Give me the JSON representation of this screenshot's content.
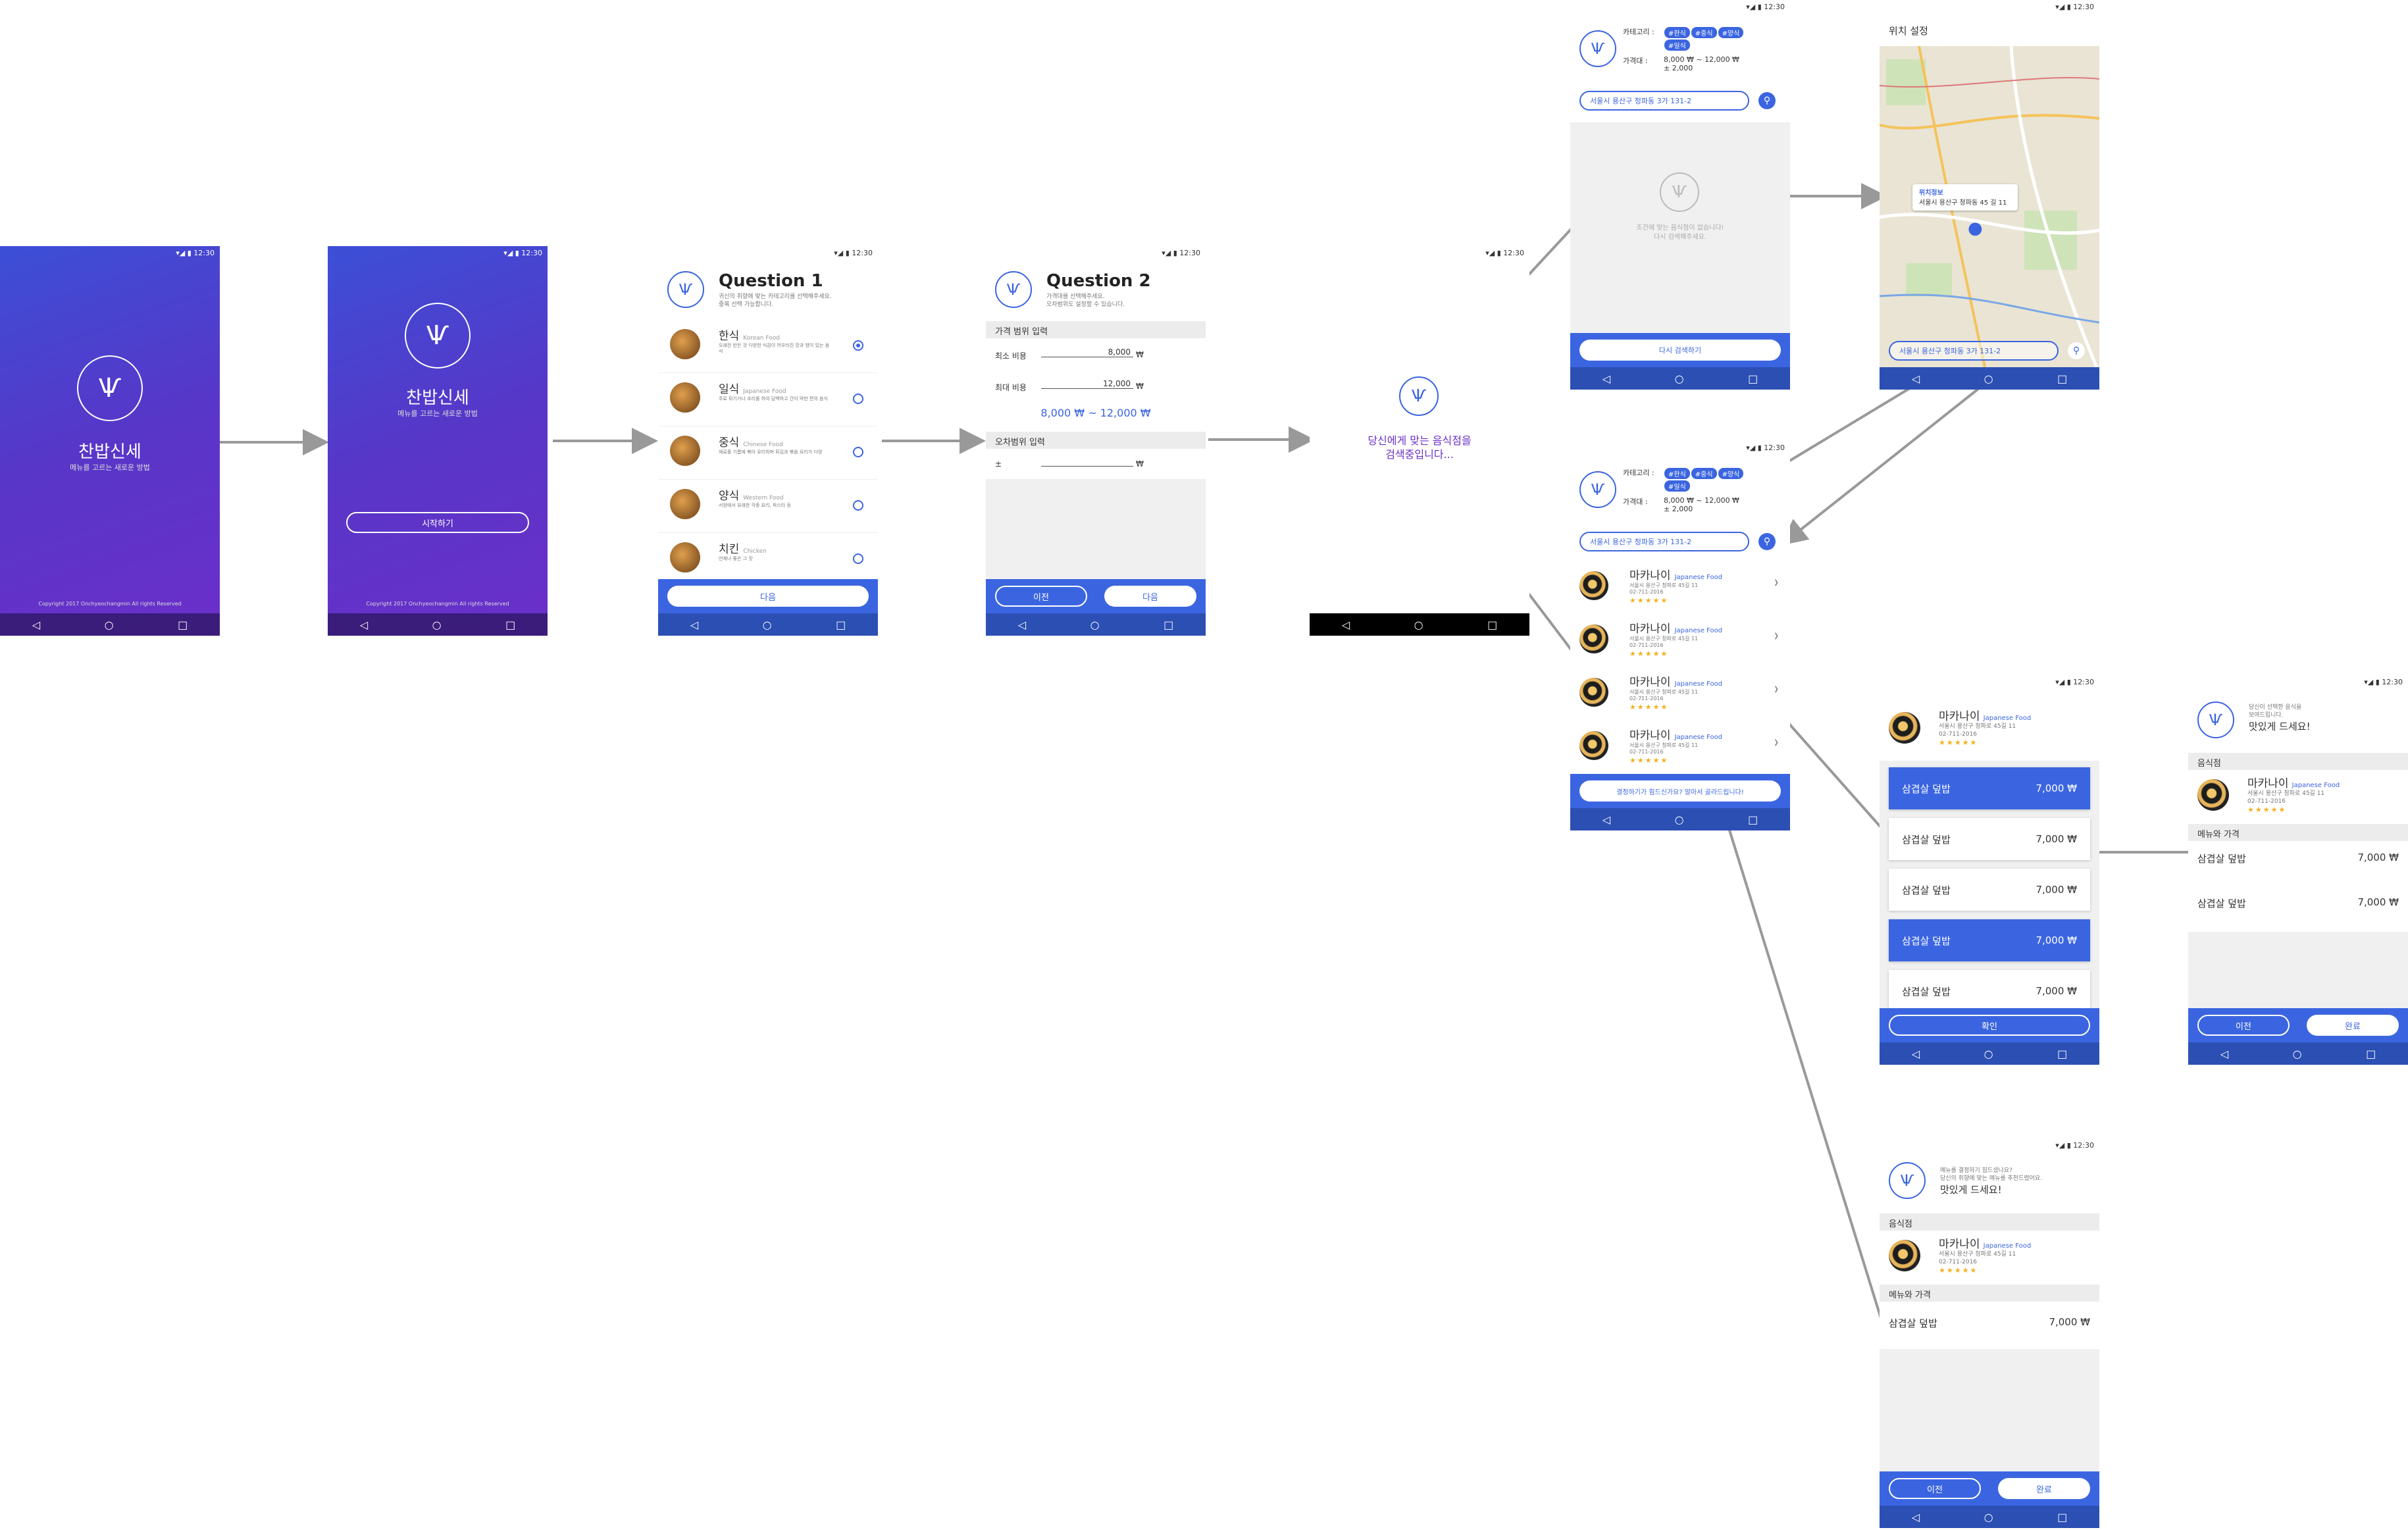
{
  "status": {
    "time": "12:30",
    "icons": "▾◢ ▮"
  },
  "nav": {
    "back": "◁",
    "home": "○",
    "recent": "□"
  },
  "splash": {
    "title": "찬밥신세",
    "subtitle": "메뉴를 고르는 새로운 방법",
    "copyright": "Copyright 2017 Onchyeochangmin All rights Reserved"
  },
  "start": {
    "button": "시작하기"
  },
  "q1": {
    "title": "Question 1",
    "desc1": "귀신의 취향에 맞는 카테고리를 선택해주세요.",
    "desc2": "중복 선택 가능합니다.",
    "next": "다음",
    "items": [
      {
        "ko": "한식",
        "en": "Korean Food",
        "desc": "오래전 만든 것 다양한 식감이 어우러진 맛과 향이 있는 음식"
      },
      {
        "ko": "일식",
        "en": "Japanese Food",
        "desc": "주로 튀기거나 조리를 하여 담백하고 간이 약한 편의 음식"
      },
      {
        "ko": "중식",
        "en": "Chinese Food",
        "desc": "재료를 기름에 볶아 요리하며 튀김과 볶음 요리가 다양"
      },
      {
        "ko": "양식",
        "en": "Western Food",
        "desc": "서양에서 유래한 각종 요리, 파스타 등"
      },
      {
        "ko": "치킨",
        "en": "Chicken",
        "desc": "언제나 좋은 그 맛"
      }
    ]
  },
  "q2": {
    "title": "Question 2",
    "desc1": "가격대를 선택해주세요.",
    "desc2": "오차범위도 설정할 수 있습니다.",
    "sec_price": "가격 범위 입력",
    "min_label": "최소 비용",
    "min_value": "8,000",
    "max_label": "최대 비용",
    "max_value": "12,000",
    "won": "₩",
    "range": "8,000 ₩ ~ 12,000 ₩",
    "sec_err": "오차범위 입력",
    "pm": "±",
    "prev": "이전",
    "next": "다음"
  },
  "loading": {
    "line1": "당신에게 맞는 음식점을",
    "line2": "검색중입니다..."
  },
  "summary": {
    "cat_label": "카테고리 :",
    "tags": [
      "#한식",
      "#중식",
      "#양식",
      "#일식"
    ],
    "price_label": "가격대 :",
    "price_value": "8,000 ₩ ~ 12,000 ₩",
    "price_err": "± 2,000",
    "address": "서울시 용산구 청파동 3가 131-2"
  },
  "empty": {
    "line1": "조건에 맞는 음식점이 없습니다!",
    "line2": "다시 검색해주세요.",
    "button": "다시 검색하기"
  },
  "map": {
    "title": "위치 설정",
    "info_title": "위치정보",
    "info_addr": "서울시 용산구 청파동 45 길 11",
    "address": "서울시 용산구 청파동 3가 131-2"
  },
  "results": {
    "items": [
      {
        "name": "마카나이",
        "cat": "Japanese Food",
        "addr": "서울시 용산구 청파로 45길 11",
        "tel": "02-711-2016",
        "stars": "★★★★★"
      },
      {
        "name": "마카나이",
        "cat": "Japanese Food",
        "addr": "서울시 용산구 청파로 45길 11",
        "tel": "02-711-2016",
        "stars": "★★★★★"
      },
      {
        "name": "마카나이",
        "cat": "Japanese Food",
        "addr": "서울시 용산구 청파로 45길 11",
        "tel": "02-711-2016",
        "stars": "★★★★★"
      },
      {
        "name": "마카나이",
        "cat": "Japanese Food",
        "addr": "서울시 용산구 청파로 45길 11",
        "tel": "02-711-2016",
        "stars": "★★★★★"
      }
    ],
    "bottom_button": "결정하기가 힘드신가요? 알아서 골라드립니다!"
  },
  "menu": {
    "name": "마카나이",
    "cat": "Japanese Food",
    "addr": "서울시 용산구 청파로 45길 11",
    "tel": "02-711-2016",
    "stars": "★★★★★",
    "items": [
      {
        "name": "삼겹살 덮밥",
        "price": "7,000 ₩"
      },
      {
        "name": "삼겹살 덮밥",
        "price": "7,000 ₩"
      },
      {
        "name": "삼겹살 덮밥",
        "price": "7,000 ₩"
      },
      {
        "name": "삼겹살 덮밥",
        "price": "7,000 ₩"
      },
      {
        "name": "삼겹살 덮밥",
        "price": "7,000 ₩"
      }
    ],
    "confirm": "확인"
  },
  "final": {
    "head1": "당신이 선택한 음식을",
    "head2": "보여드립니다.",
    "enjoy": "맛있게 드세요!",
    "sec_rest": "음식점",
    "sec_menu": "메뉴와 가격",
    "menu1": "삼겹살 덮밥",
    "price1": "7,000 ₩",
    "menu2": "삼겹살 덮밥",
    "price2": "7,000 ₩",
    "prev": "이전",
    "done": "완료"
  },
  "random": {
    "head1": "메뉴를 결정하기 힘드셨나요?",
    "head2": "당신의 취향에 맞는 메뉴를 추천드렸어요.",
    "enjoy": "맛있게 드세요!",
    "sec_rest": "음식점",
    "sec_menu": "메뉴와 가격",
    "menu1": "삼겹살 덮밥",
    "price1": "7,000 ₩",
    "prev": "이전",
    "done": "완료"
  },
  "colors": {
    "primary": "#3b65e0",
    "nav": "#2b4fb3",
    "purple": "#6b2fc9"
  }
}
